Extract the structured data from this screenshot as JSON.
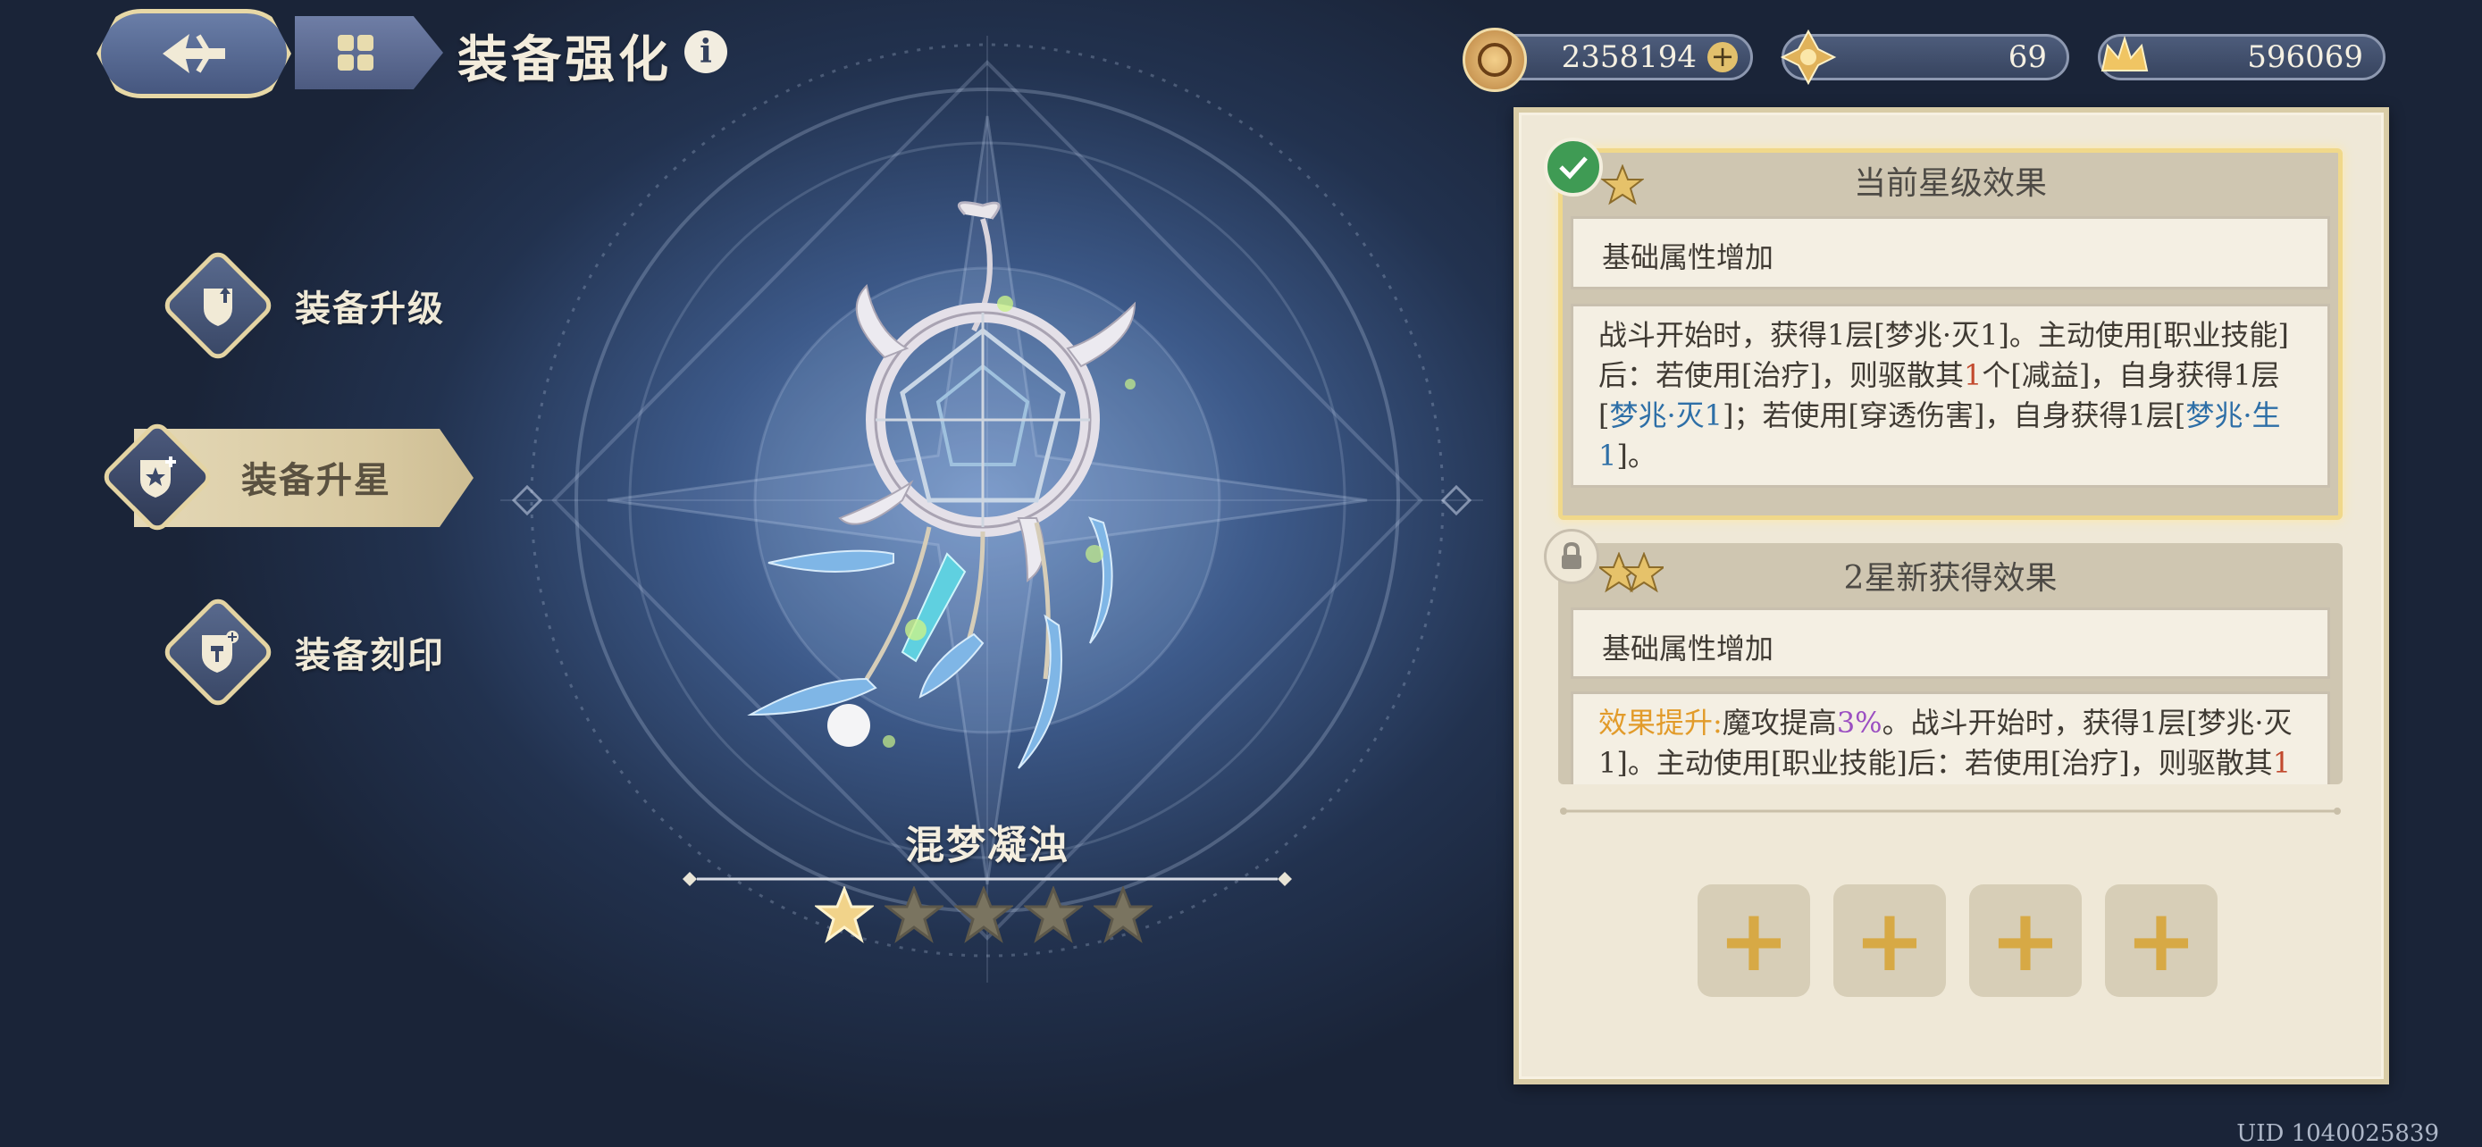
{
  "header": {
    "title": "装备强化",
    "info_label": "i"
  },
  "resources": [
    {
      "icon": "coin-icon",
      "value": "2358194"
    },
    {
      "icon": "crystal-icon",
      "value": "69"
    },
    {
      "icon": "gold-crown-icon",
      "value": "596069"
    }
  ],
  "menu": {
    "items": [
      {
        "label": "装备升级",
        "icon": "upgrade-icon",
        "active": false
      },
      {
        "label": "装备升星",
        "icon": "star-up-icon",
        "active": true
      },
      {
        "label": "装备刻印",
        "icon": "engrave-icon",
        "active": false
      }
    ]
  },
  "item": {
    "name": "混梦凝浊",
    "stars_total": 5,
    "stars_filled": 1
  },
  "panel": {
    "current": {
      "title": "当前星级效果",
      "basic": "基础属性增加",
      "effect_parts": [
        {
          "t": "战斗开始时，获得1层[梦兆·灭1]。主动使用[职业技能]后：若使用[治疗]，则驱散其",
          "c": ""
        },
        {
          "t": "1",
          "c": "red"
        },
        {
          "t": "个[减益]，自身获得1层[",
          "c": ""
        },
        {
          "t": "梦兆·灭1",
          "c": "blue"
        },
        {
          "t": "]；若使用[穿透伤害]，自身获得1层[",
          "c": ""
        },
        {
          "t": "梦兆·生1",
          "c": "blue"
        },
        {
          "t": "]。",
          "c": ""
        }
      ]
    },
    "next": {
      "title": "2星新获得效果",
      "basic": "基础属性增加",
      "effect_parts": [
        {
          "t": "效果提升:",
          "c": "orange"
        },
        {
          "t": "魔攻提高",
          "c": ""
        },
        {
          "t": "3%",
          "c": "purple"
        },
        {
          "t": "。战斗开始时，获得1层[梦兆·灭1]。主动使用[职业技能]后：若使用[治疗]，则驱散其",
          "c": ""
        },
        {
          "t": "1",
          "c": "red"
        }
      ]
    },
    "slots": [
      "+",
      "+",
      "+",
      "+"
    ]
  },
  "uid": "UID 1040025839",
  "colors": {
    "accent_gold": "#e4d4a3",
    "panel_bg": "#efe8d7",
    "highlight_blue": "#2e6fa7",
    "highlight_red": "#c24a2e",
    "highlight_purple": "#9b4fc2",
    "highlight_orange": "#e29b2a"
  }
}
